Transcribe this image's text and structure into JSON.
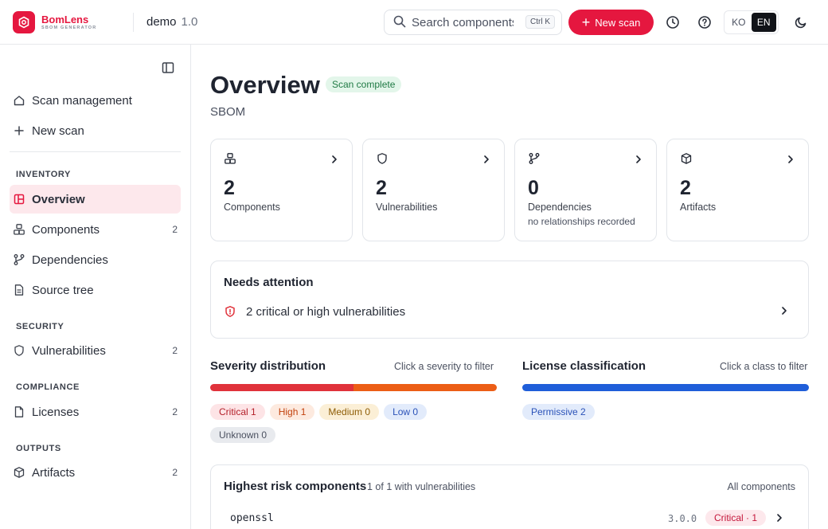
{
  "brand": {
    "name": "BomLens",
    "tagline": "SBOM GENERATOR"
  },
  "project": {
    "name": "demo",
    "version": "1.0"
  },
  "search": {
    "placeholder": "Search components",
    "shortcut": "Ctrl K"
  },
  "header": {
    "new_scan_label": "New scan",
    "languages": [
      "KO",
      "EN"
    ],
    "active_language": "EN"
  },
  "sidebar": {
    "top_items": [
      {
        "label": "Scan management"
      },
      {
        "label": "New scan"
      }
    ],
    "sections": {
      "inventory": "INVENTORY",
      "security": "SECURITY",
      "compliance": "COMPLIANCE",
      "outputs": "OUTPUTS"
    },
    "items": {
      "overview": {
        "label": "Overview",
        "count": ""
      },
      "components": {
        "label": "Components",
        "count": "2"
      },
      "dependencies": {
        "label": "Dependencies",
        "count": ""
      },
      "source_tree": {
        "label": "Source tree",
        "count": ""
      },
      "vulnerabilities": {
        "label": "Vulnerabilities",
        "count": "2"
      },
      "licenses": {
        "label": "Licenses",
        "count": "2"
      },
      "artifacts": {
        "label": "Artifacts",
        "count": "2"
      }
    }
  },
  "page": {
    "title": "Overview",
    "status_badge": "Scan complete",
    "subtitle": "SBOM"
  },
  "stats": [
    {
      "value": "2",
      "label": "Components",
      "note": "",
      "icon": "components-icon"
    },
    {
      "value": "2",
      "label": "Vulnerabilities",
      "note": "",
      "icon": "shield-icon"
    },
    {
      "value": "0",
      "label": "Dependencies",
      "note": "no relationships recorded",
      "icon": "branch-icon"
    },
    {
      "value": "2",
      "label": "Artifacts",
      "note": "",
      "icon": "package-icon"
    }
  ],
  "attention": {
    "title": "Needs attention",
    "items": [
      {
        "text": "2 critical or high vulnerabilities"
      }
    ]
  },
  "severity": {
    "title": "Severity distribution",
    "hint": "Click a severity to filter",
    "segments": [
      {
        "label": "Critical 1",
        "fraction": 0.5,
        "color": "#e0323b",
        "chip_bg": "#fde4e6",
        "chip_fg": "#b4202a"
      },
      {
        "label": "High 1",
        "fraction": 0.5,
        "color": "#ec5e16",
        "chip_bg": "#fdeadf",
        "chip_fg": "#c2420d"
      },
      {
        "label": "Medium 0",
        "fraction": 0,
        "color": "#d69a12",
        "chip_bg": "#fbefd6",
        "chip_fg": "#8e5d06"
      },
      {
        "label": "Low 0",
        "fraction": 0,
        "color": "#2a5bd7",
        "chip_bg": "#e2ebfb",
        "chip_fg": "#2a52b8"
      },
      {
        "label": "Unknown 0",
        "fraction": 0,
        "color": "#9aa1ad",
        "chip_bg": "#e8eaee",
        "chip_fg": "#4b5160"
      }
    ]
  },
  "license": {
    "title": "License classification",
    "hint": "Click a class to filter",
    "segments": [
      {
        "label": "Permissive 2",
        "fraction": 1,
        "color": "#1f5ed9",
        "chip_bg": "#e2ebfb",
        "chip_fg": "#2a52b8"
      }
    ]
  },
  "risk": {
    "title": "Highest risk components",
    "meta": "1 of 1 with vulnerabilities",
    "all_link": "All components",
    "rows": [
      {
        "name": "openssl",
        "version": "3.0.0",
        "severity": "Critical · 1"
      }
    ]
  }
}
